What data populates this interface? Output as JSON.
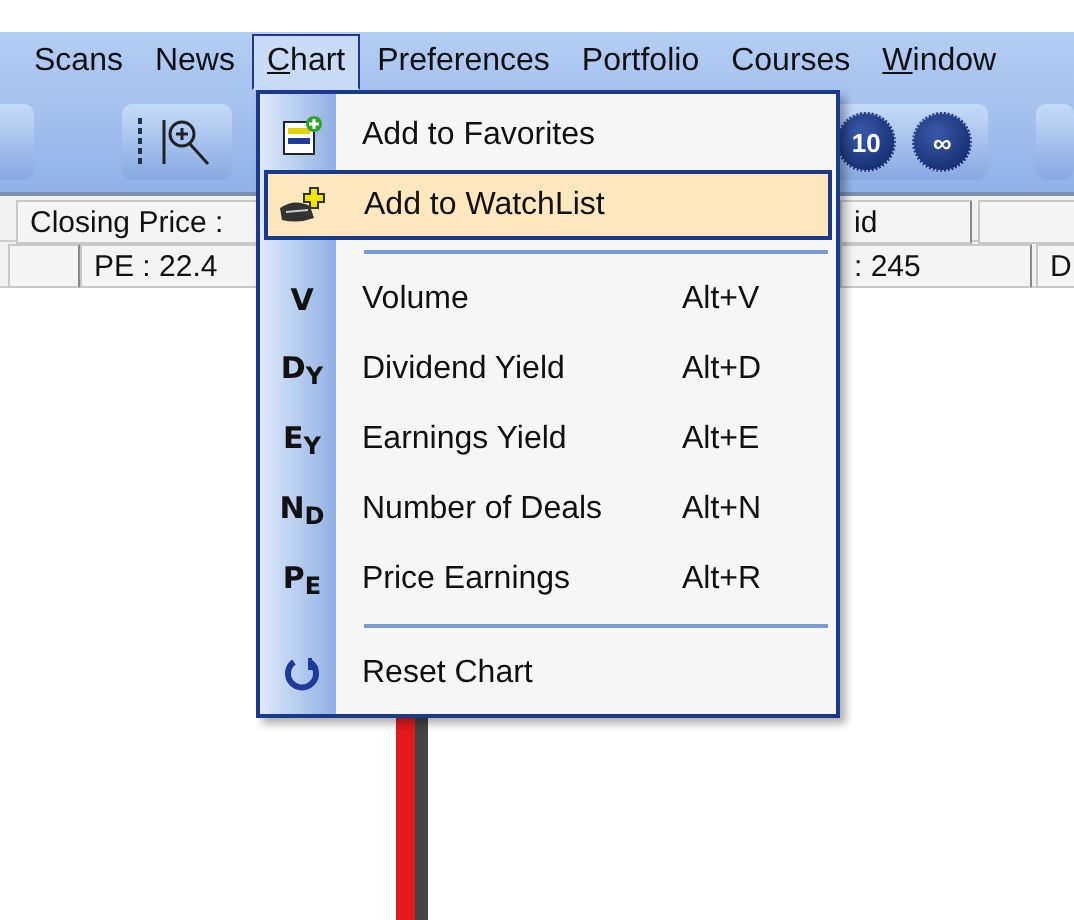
{
  "menubar": [
    {
      "label": "Scans",
      "open": false,
      "underline_first": false
    },
    {
      "label": "News",
      "open": false,
      "underline_first": false
    },
    {
      "label": "Chart",
      "open": true,
      "underline_first": true
    },
    {
      "label": "Preferences",
      "open": false,
      "underline_first": false
    },
    {
      "label": "Portfolio",
      "open": false,
      "underline_first": false
    },
    {
      "label": "Courses",
      "open": false,
      "underline_first": false
    },
    {
      "label": "Window",
      "open": false,
      "underline_first": true
    }
  ],
  "toolbar": {
    "buttons": [
      {
        "label": "10"
      },
      {
        "label": "∞"
      }
    ]
  },
  "info_rows": [
    [
      {
        "text": "Closing Price :"
      },
      {
        "text": "id"
      }
    ],
    [
      {
        "text": "PE : 22.4"
      },
      {
        "text": ": 245"
      },
      {
        "text": "D"
      }
    ]
  ],
  "menu": {
    "items": [
      {
        "kind": "favorites",
        "label": "Add to Favorites",
        "selected": false
      },
      {
        "kind": "watchlist",
        "label": "Add to WatchList",
        "selected": true
      },
      {
        "kind": "separator"
      },
      {
        "kind": "letter",
        "glyph": "V",
        "label": "Volume",
        "shortcut": "Alt+V",
        "selected": false
      },
      {
        "kind": "letter",
        "glyph": "D$_{Y}$",
        "label": "Dividend Yield",
        "shortcut": "Alt+D",
        "selected": false
      },
      {
        "kind": "letter",
        "glyph": "E$_{Y}$",
        "label": "Earnings Yield",
        "shortcut": "Alt+E",
        "selected": false
      },
      {
        "kind": "letter",
        "glyph": "N$_{D}$",
        "label": "Number of Deals",
        "shortcut": "Alt+N",
        "selected": false
      },
      {
        "kind": "letter",
        "glyph": "P$_{E}$",
        "label": "Price Earnings",
        "shortcut": "Alt+R",
        "selected": false
      },
      {
        "kind": "separator"
      },
      {
        "kind": "reset",
        "label": "Reset Chart",
        "selected": false
      }
    ]
  }
}
